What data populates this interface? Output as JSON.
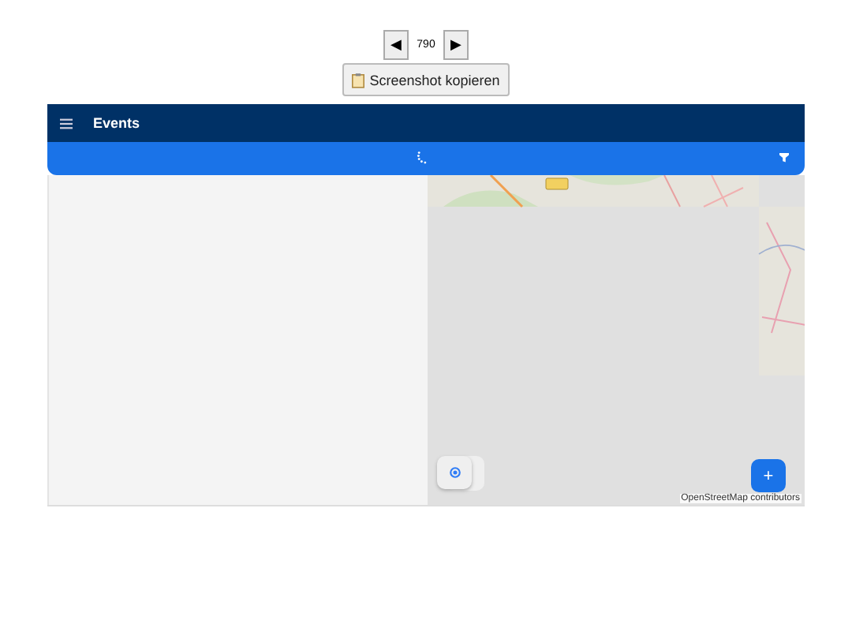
{
  "pager": {
    "prev": "◀",
    "page": "790",
    "next": "▶"
  },
  "copy_button": {
    "label": "Screenshot kopieren"
  },
  "app_bar": {
    "title": "Events"
  },
  "map": {
    "kind": "picture",
    "attribution": "OpenStreetMap contributors",
    "add_button": "+"
  }
}
